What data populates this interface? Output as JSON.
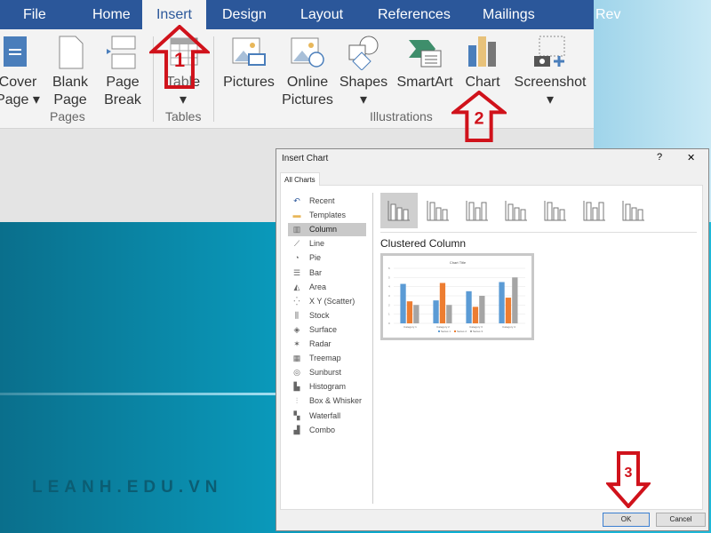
{
  "tabs": [
    "File",
    "Home",
    "Insert",
    "Design",
    "Layout",
    "References",
    "Mailings",
    "Rev"
  ],
  "active_tab": "Insert",
  "ribbon": {
    "buttons": [
      {
        "l1": "Cover",
        "l2": "Page ▾",
        "icon": "cover-page-icon"
      },
      {
        "l1": "Blank",
        "l2": "Page",
        "icon": "blank-page-icon"
      },
      {
        "l1": "Page",
        "l2": "Break",
        "icon": "page-break-icon"
      },
      {
        "l1": "Table",
        "l2": "▾",
        "icon": "table-icon"
      },
      {
        "l1": "Pictures",
        "l2": "",
        "icon": "pictures-icon"
      },
      {
        "l1": "Online",
        "l2": "Pictures",
        "icon": "online-pictures-icon"
      },
      {
        "l1": "Shapes",
        "l2": "▾",
        "icon": "shapes-icon"
      },
      {
        "l1": "SmartArt",
        "l2": "",
        "icon": "smartart-icon"
      },
      {
        "l1": "Chart",
        "l2": "",
        "icon": "chart-icon"
      },
      {
        "l1": "Screenshot",
        "l2": "▾",
        "icon": "screenshot-icon"
      }
    ],
    "groups": [
      "Pages",
      "Tables",
      "Illustrations"
    ]
  },
  "steps": [
    "1",
    "2",
    "3"
  ],
  "watermark": "LEANH.EDU.VN",
  "dialog": {
    "title": "Insert Chart",
    "help": "?",
    "close": "✕",
    "tab": "All Charts",
    "types": [
      "Recent",
      "Templates",
      "Column",
      "Line",
      "Pie",
      "Bar",
      "Area",
      "X Y (Scatter)",
      "Stock",
      "Surface",
      "Radar",
      "Treemap",
      "Sunburst",
      "Histogram",
      "Box & Whisker",
      "Waterfall",
      "Combo"
    ],
    "selected_type": "Column",
    "subtype_title": "Clustered Column",
    "ok": "OK",
    "cancel": "Cancel"
  },
  "colors": {
    "accent": "#2b579a",
    "arrow": "#d0121b",
    "s1": "#5b9bd5",
    "s2": "#ed7d31",
    "s3": "#a5a5a5"
  },
  "chart_data": {
    "type": "bar",
    "title": "Chart Title",
    "categories": [
      "Category 1",
      "Category 2",
      "Category 3",
      "Category 4"
    ],
    "series": [
      {
        "name": "Series 1",
        "values": [
          4.3,
          2.5,
          3.5,
          4.5
        ]
      },
      {
        "name": "Series 2",
        "values": [
          2.4,
          4.4,
          1.8,
          2.8
        ]
      },
      {
        "name": "Series 3",
        "values": [
          2,
          2,
          3,
          5
        ]
      }
    ],
    "ylim": [
      0,
      6
    ],
    "grid": true,
    "legend": "bottom"
  }
}
